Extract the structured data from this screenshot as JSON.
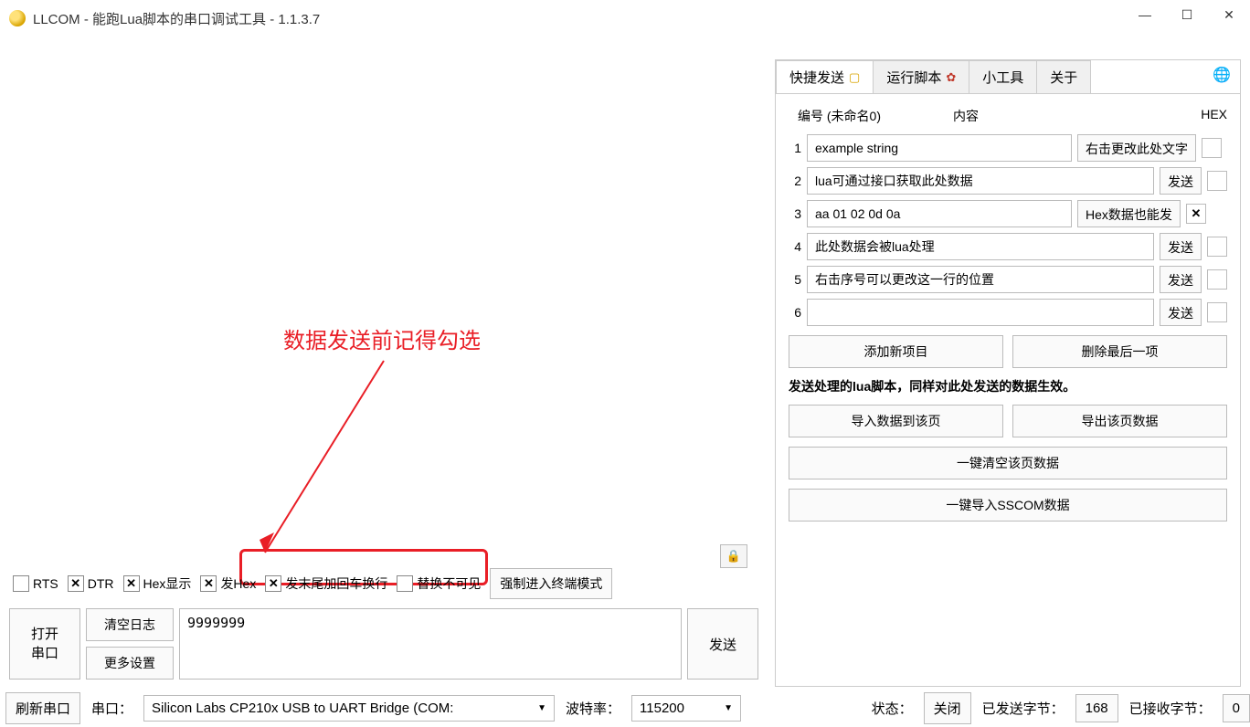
{
  "titlebar": {
    "title": "LLCOM - 能跑Lua脚本的串口调试工具 - 1.1.3.7"
  },
  "annotation": {
    "text": "数据发送前记得勾选"
  },
  "checkbox_row": {
    "rts": "RTS",
    "dtr": "DTR",
    "hex_display": "Hex显示",
    "send_hex": "发Hex",
    "append_crlf": "发末尾加回车换行",
    "replace_invisible": "替换不可见",
    "terminal_mode": "强制进入终端模式"
  },
  "send_area": {
    "open_port": "打开\n串口",
    "clear_log": "清空日志",
    "more_settings": "更多设置",
    "input_value": "9999999",
    "send": "发送"
  },
  "tabs": {
    "quick_send": "快捷发送",
    "run_script": "运行脚本",
    "tools": "小工具",
    "about": "关于"
  },
  "quick_panel": {
    "header_num": "编号 (未命名0)",
    "header_content": "内容",
    "header_hex": "HEX",
    "rows": [
      {
        "idx": "1",
        "content": "example string",
        "action": "右击更改此处文字",
        "hex": false,
        "wide_input": false
      },
      {
        "idx": "2",
        "content": "lua可通过接口获取此处数据",
        "action": "发送",
        "hex": false,
        "wide_input": true
      },
      {
        "idx": "3",
        "content": "aa 01 02 0d 0a",
        "action": "Hex数据也能发",
        "hex": true,
        "wide_input": false
      },
      {
        "idx": "4",
        "content": "此处数据会被lua处理",
        "action": "发送",
        "hex": false,
        "wide_input": true
      },
      {
        "idx": "5",
        "content": "右击序号可以更改这一行的位置",
        "action": "发送",
        "hex": false,
        "wide_input": true
      },
      {
        "idx": "6",
        "content": "",
        "action": "发送",
        "hex": false,
        "wide_input": true
      }
    ],
    "add_item": "添加新项目",
    "delete_last": "删除最后一项",
    "note": "发送处理的lua脚本，同样对此处发送的数据生效。",
    "import_data": "导入数据到该页",
    "export_data": "导出该页数据",
    "clear_page": "一键清空该页数据",
    "import_sscom": "一键导入SSCOM数据"
  },
  "statusbar": {
    "refresh": "刷新串口",
    "port_label": "串口：",
    "port_value": "Silicon Labs CP210x USB to UART Bridge (COM:",
    "baud_label": "波特率：",
    "baud_value": "115200",
    "state_label": "状态：",
    "state_value": "关闭",
    "sent_label": "已发送字节：",
    "sent_value": "168",
    "recv_label": "已接收字节：",
    "recv_value": "0"
  }
}
